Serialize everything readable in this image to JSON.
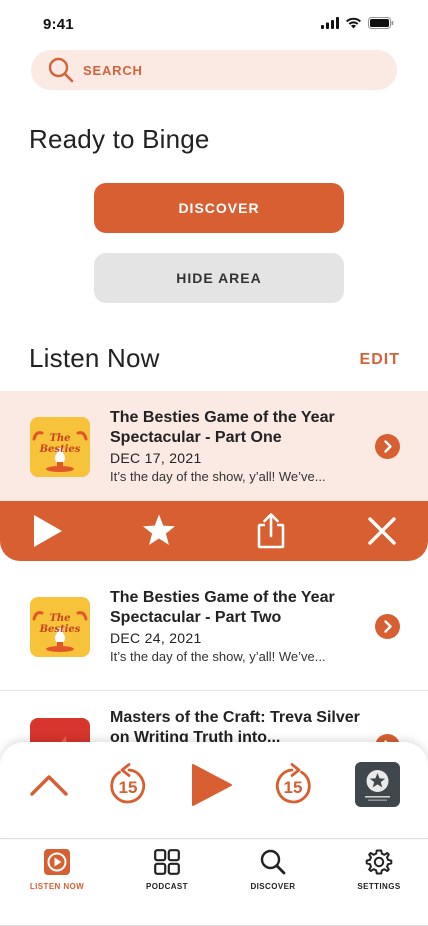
{
  "status_bar": {
    "time": "9:41"
  },
  "search": {
    "placeholder": "SEARCH"
  },
  "binge": {
    "title": "Ready to Binge",
    "discover_label": "DISCOVER",
    "hide_label": "HIDE AREA"
  },
  "listen_now": {
    "title": "Listen Now",
    "edit_label": "EDIT",
    "episodes": [
      {
        "title": "The Besties Game of the Year Spectacular - Part One",
        "date": "DEC 17, 2021",
        "description": "It’s the day of the show, y’all! We’ve...",
        "artwork": "The Besties"
      },
      {
        "title": "The Besties Game of the Year Spectacular - Part Two",
        "date": "DEC 24, 2021",
        "description": "It’s the day of the show, y’all! We’ve...",
        "artwork": "The Besties"
      },
      {
        "title": "Masters of the Craft: Treva Silver on Writing Truth into...",
        "date": "",
        "description": ""
      }
    ]
  },
  "episode_actions": {
    "icons": [
      "play-icon",
      "star-icon",
      "share-icon",
      "close-icon"
    ]
  },
  "player": {
    "skip_back_seconds": "15",
    "skip_forward_seconds": "15"
  },
  "tabs": [
    {
      "label": "LISTEN NOW",
      "icon": "play-square-icon",
      "active": true
    },
    {
      "label": "PODCAST",
      "icon": "grid-icon",
      "active": false
    },
    {
      "label": "DISCOVER",
      "icon": "search-icon",
      "active": false
    },
    {
      "label": "SETTINGS",
      "icon": "gear-icon",
      "active": false
    }
  ],
  "colors": {
    "accent": "#d75f32",
    "accent_tint": "#fbe9e3",
    "button_gray": "#e4e4e4"
  }
}
